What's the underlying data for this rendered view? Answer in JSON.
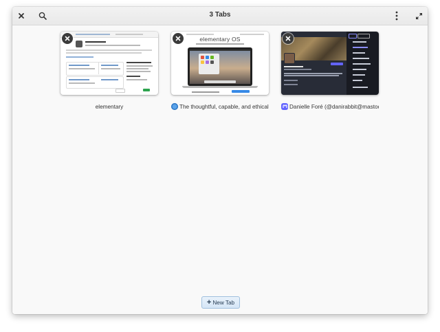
{
  "header": {
    "title": "3 Tabs",
    "close_icon": "close-icon",
    "search_icon": "search-icon",
    "menu_icon": "menu-icon",
    "fullscreen_icon": "fullscreen-icon"
  },
  "tabs": [
    {
      "label": "elementary",
      "favicon": ""
    },
    {
      "label": "The thoughtful, capable, and ethical re",
      "favicon": "elementary-logo-icon"
    },
    {
      "label": "Danielle Foré (@danirabbit@mastodon.s",
      "favicon": "mastodon-icon"
    }
  ],
  "thumb2": {
    "heading": "elementary OS"
  },
  "new_tab": {
    "label": "New Tab"
  },
  "colors": {
    "accent": "#3689e6",
    "mastodon": "#6364ff",
    "dark_bg": "#282c37"
  }
}
